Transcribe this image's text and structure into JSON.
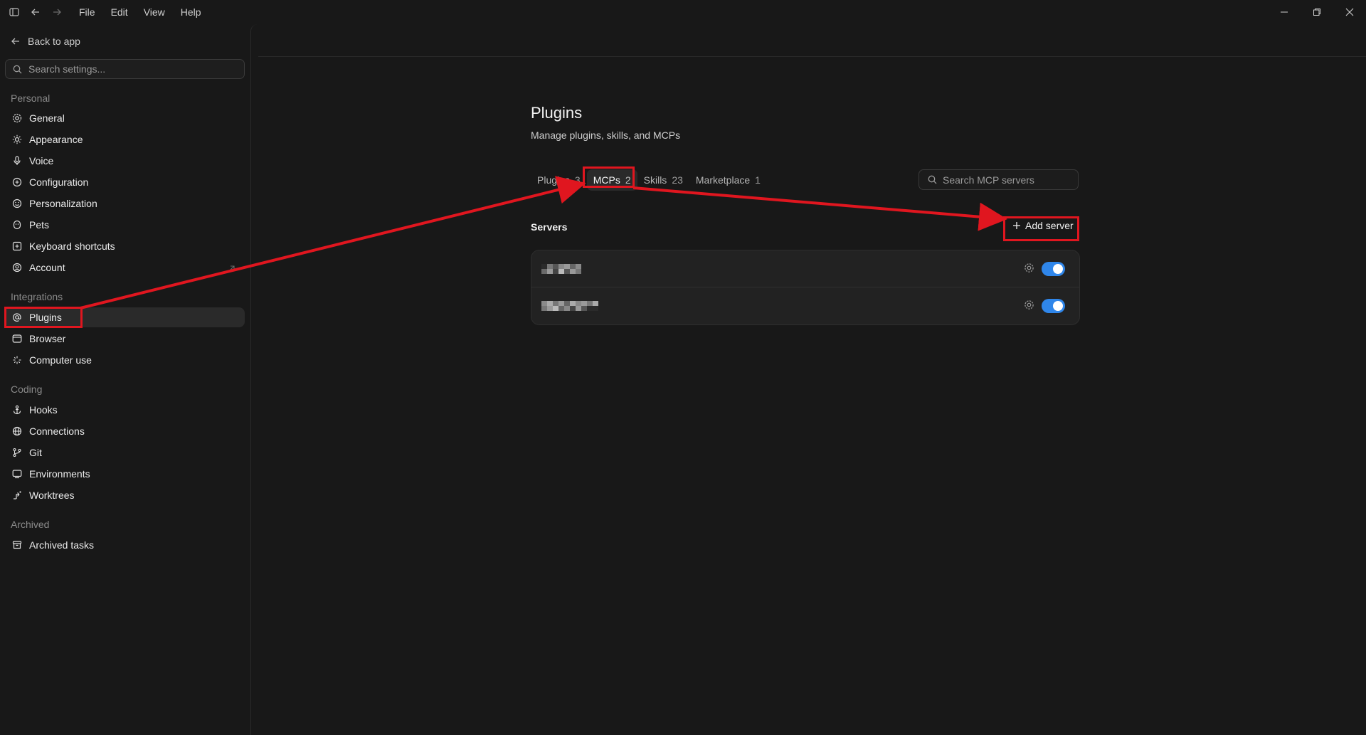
{
  "menu": {
    "items": [
      "File",
      "Edit",
      "View",
      "Help"
    ]
  },
  "sidebar": {
    "back_label": "Back to app",
    "search_placeholder": "Search settings...",
    "sections": {
      "personal": "Personal",
      "integrations": "Integrations",
      "coding": "Coding",
      "archived": "Archived"
    },
    "personal_items": [
      {
        "label": "General",
        "icon": "gear-icon"
      },
      {
        "label": "Appearance",
        "icon": "sun-icon"
      },
      {
        "label": "Voice",
        "icon": "mic-icon"
      },
      {
        "label": "Configuration",
        "icon": "config-icon"
      },
      {
        "label": "Personalization",
        "icon": "personalization-icon"
      },
      {
        "label": "Pets",
        "icon": "pet-icon"
      },
      {
        "label": "Keyboard shortcuts",
        "icon": "keyboard-icon"
      },
      {
        "label": "Account",
        "icon": "account-icon"
      }
    ],
    "integration_items": [
      {
        "label": "Plugins",
        "icon": "at-icon"
      },
      {
        "label": "Browser",
        "icon": "browser-icon"
      },
      {
        "label": "Computer use",
        "icon": "sparkle-icon"
      }
    ],
    "coding_items": [
      {
        "label": "Hooks",
        "icon": "anchor-icon"
      },
      {
        "label": "Connections",
        "icon": "globe-icon"
      },
      {
        "label": "Git",
        "icon": "branch-icon"
      },
      {
        "label": "Environments",
        "icon": "monitor-icon"
      },
      {
        "label": "Worktrees",
        "icon": "worktree-icon"
      }
    ],
    "archived_items": [
      {
        "label": "Archived tasks",
        "icon": "archive-icon"
      }
    ]
  },
  "main": {
    "title": "Plugins",
    "subtitle": "Manage plugins, skills, and MCPs",
    "tabs": [
      {
        "label": "Plugins",
        "count": "3"
      },
      {
        "label": "MCPs",
        "count": "2"
      },
      {
        "label": "Skills",
        "count": "23"
      },
      {
        "label": "Marketplace",
        "count": "1"
      }
    ],
    "search_placeholder": "Search MCP servers",
    "servers_heading": "Servers",
    "add_server_label": "Add server",
    "servers": [
      {
        "name_redacted": true,
        "enabled": true
      },
      {
        "name_redacted": true,
        "enabled": true
      }
    ]
  },
  "colors": {
    "background": "#181818",
    "accent_toggle": "#2f86ea",
    "annotation": "#e0161f"
  }
}
